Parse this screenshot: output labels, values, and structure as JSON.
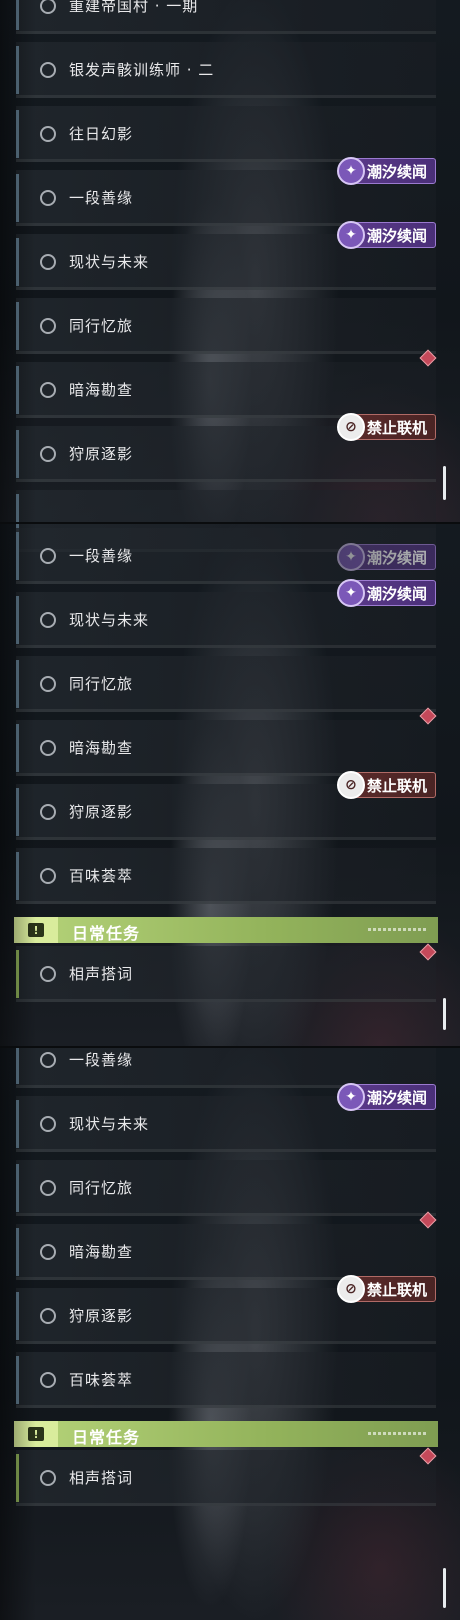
{
  "quests": {
    "q_partial": "重建帝国村 · 一期",
    "q_silver": "银发声骸训练师 · 二",
    "q_old": "往日幻影",
    "q_fate": "一段善缘",
    "q_now": "现状与未来",
    "q_travel": "同行忆旅",
    "q_sea": "暗海勘查",
    "q_hunt": "狩原逐影",
    "q_taste": "百味荟萃",
    "q_cross": "相声搭词"
  },
  "tags": {
    "tide": "潮汐续闻",
    "nolink": "禁止联机"
  },
  "section": {
    "daily_title": "日常任务"
  },
  "colors": {
    "row_accent": "#617c90",
    "daily_accent": "#8fb05a",
    "tide_tag": "#5b3a8a",
    "nolink_tag": "#5a2a2a",
    "marker": "#c4495a"
  },
  "icons": {
    "tide": "tide-story-icon",
    "nolink": "no-coop-icon",
    "daily": "exclamation-icon",
    "marker": "diamond-marker-icon"
  }
}
